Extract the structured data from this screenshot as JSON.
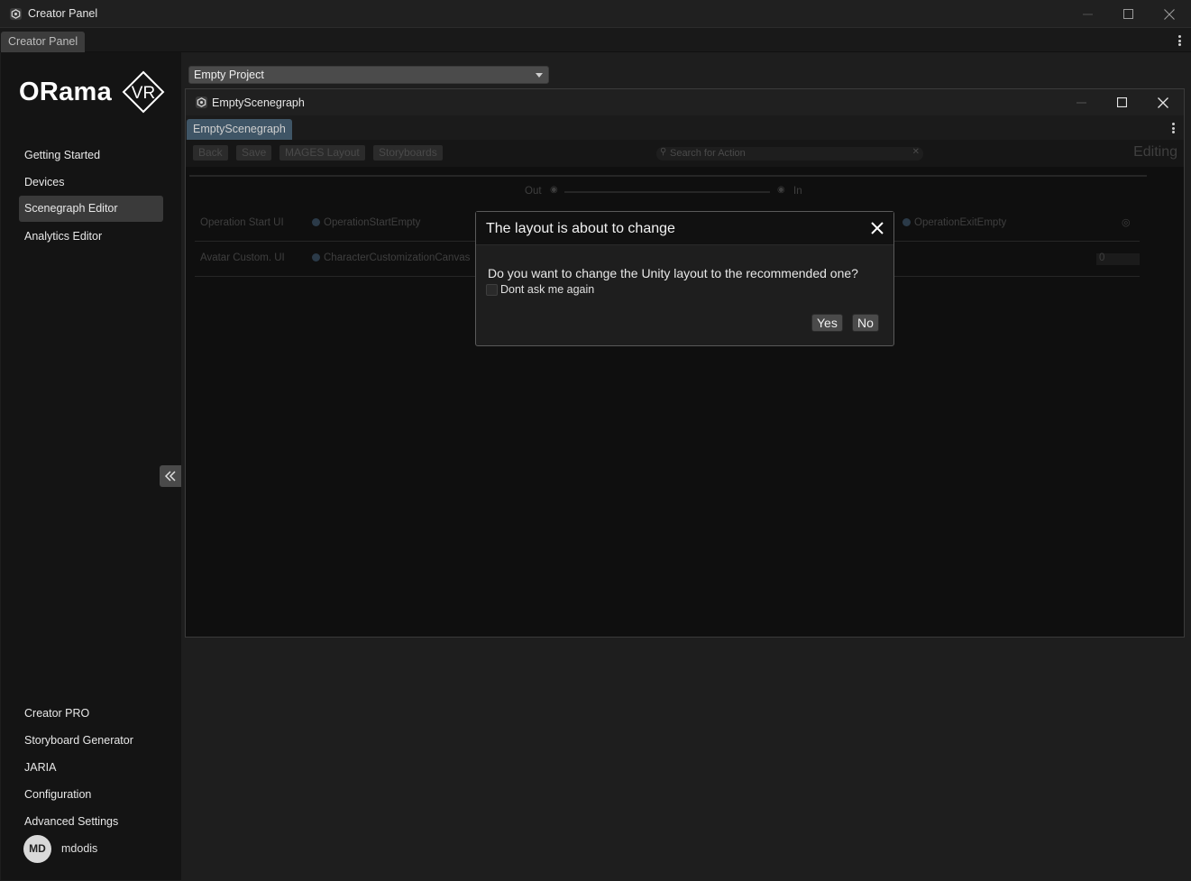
{
  "window": {
    "title": "Creator Panel",
    "tab": "Creator Panel"
  },
  "sidebar": {
    "logo_text": "ORama",
    "logo_badge": "VR",
    "top_items": [
      {
        "label": "Getting Started"
      },
      {
        "label": "Devices"
      },
      {
        "label": "Scenegraph Editor",
        "active": true
      },
      {
        "label": "Analytics Editor"
      }
    ],
    "bottom_items": [
      {
        "label": "Creator PRO"
      },
      {
        "label": "Storyboard Generator"
      },
      {
        "label": "JARIA"
      },
      {
        "label": "Configuration"
      },
      {
        "label": "Advanced Settings"
      }
    ],
    "user": {
      "initials": "MD",
      "name": "mdodis"
    }
  },
  "main": {
    "project_select": {
      "value": "Empty Project"
    }
  },
  "scenegraph_window": {
    "title": "EmptyScenegraph",
    "tab": "EmptyScenegraph",
    "toolbar": {
      "back": "Back",
      "save": "Save",
      "layout": "MAGES Layout",
      "storyboards": "Storyboards",
      "search_placeholder": "Search for Action",
      "mode": "Editing"
    },
    "ports": {
      "out": "Out",
      "in": "In"
    },
    "rows": [
      {
        "label": "Operation Start UI",
        "value": "OperationStartEmpty",
        "exit_value": "OperationExitEmpty"
      },
      {
        "label": "Avatar Custom. UI",
        "value": "CharacterCustomizationCanvas",
        "number": "0"
      }
    ]
  },
  "dialog": {
    "title": "The layout is about to change",
    "message": "Do you want to change the Unity layout to the recommended one?",
    "checkbox_label": "Dont ask me again",
    "yes": "Yes",
    "no": "No"
  },
  "colors": {
    "background": "#1e1e1e",
    "sidebar": "#141414",
    "active_item": "#3a3a3a",
    "tab_active": "#3f5566"
  }
}
